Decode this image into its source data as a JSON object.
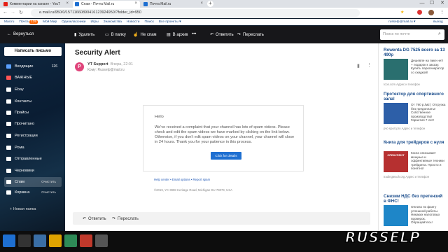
{
  "browser": {
    "tabs": [
      {
        "title": "Комментарии на канале - YouT",
        "fav": "#e62117"
      },
      {
        "title": "Спам - Почта Mail.ru",
        "fav": "#1e6fd1"
      },
      {
        "title": "Почта Mail.ru",
        "fav": "#1e6fd1"
      }
    ],
    "new_tab": "+",
    "url": "e.mail.ru/950/0/15711660890416123924950/?folder_id=950",
    "win_min": "—",
    "win_max": "☐",
    "win_close": "✕"
  },
  "mailnav": {
    "items": [
      "Mail.ru",
      "Почта",
      "Мой Мир",
      "Одноклассники",
      "Игры",
      "Знакомства",
      "Новости",
      "Поиск",
      "Все проекты ▾"
    ],
    "badge": "139",
    "user": "russelp@mail.ru ▾",
    "logout": "выход"
  },
  "toolbar": {
    "back": "Вернуться",
    "delete": "Удалить",
    "to_folder": "В папку",
    "not_spam": "Не спам",
    "archive": "В архив",
    "more": "•••",
    "reply": "Ответить",
    "forward": "Переслать"
  },
  "search": {
    "placeholder": "Поиск по почте"
  },
  "sidebar": {
    "compose": "Написать письмо",
    "folders": [
      {
        "label": "Входящие",
        "count": "126",
        "color": "#5aa0ff"
      },
      {
        "label": "ВАЖНЫЕ",
        "count": "",
        "color": "#ff5555"
      },
      {
        "label": "Ebay",
        "count": "",
        "color": "#ffffff"
      },
      {
        "label": "Контакты",
        "count": "",
        "color": "#ffffff"
      },
      {
        "label": "Прайсы",
        "count": "",
        "color": "#ffffff"
      },
      {
        "label": "Прочитано",
        "count": "",
        "color": "#ffffff"
      },
      {
        "label": "Регистрации",
        "count": "",
        "color": "#ffffff"
      },
      {
        "label": "Рома",
        "count": "",
        "color": "#ffffff"
      },
      {
        "label": "Отправленные",
        "count": "",
        "color": "#ffffff"
      },
      {
        "label": "Черновики",
        "count": "",
        "color": "#ffffff"
      },
      {
        "label": "Спам",
        "count": "",
        "color": "#ffffff"
      },
      {
        "label": "Корзина",
        "count": "",
        "color": "#ffffff"
      }
    ],
    "spam_clear": "Очистить",
    "trash_clear": "Очистить",
    "new_folder": "Новая папка"
  },
  "message": {
    "subject": "Security Alert",
    "avatar": "P",
    "from": "YT Support",
    "date": "Вчера, 22:01",
    "to": "Кому: Russelp@mail.ru",
    "body_hello": "Hello",
    "body_text": "We've received a complaint that your channel has lots of spam videos. Please check and edit the spam videos we have marked by clicking on the link below. Otherwise, if you don't edit spam videos on your channel, your channel will close in 24 hours. Thank you for your patience in this process.",
    "button": "Click for details",
    "footer_links": "Help center • Email options • Report spam",
    "footer_addr": "©2019, YC 3998 Heritage Road, Michigan DU 79079, USA",
    "reply": "Ответить",
    "forward": "Переслать"
  },
  "ads": [
    {
      "title": "Rowenta DG 7525 всего за 13 490р",
      "desc": "Дешевле на пике нет! + подарок к заказу. Купить парогенератор со скидкой!",
      "src": "Icon.com  Адрес и телефон"
    },
    {
      "title": "Протектор для спортивного зала!",
      "desc": "От 790 р./м2 | Отгрузка без предоплаты! Собственное производство! Гарантия 7 лет!",
      "src": "pvc-sport.pro  Адрес и телефон"
    },
    {
      "title": "Книга для трейдеров с нуля",
      "desc": "Книга описывает мощные и эффективные техники трейдинга. Просто и понятно!",
      "src": "tradingteach.org  Адрес и телефон"
    },
    {
      "title": "Снизим НДС без претензий в ФНС!",
      "desc": "Оплата по факту успешной работы. Никаких налоговых проверок. Обращайтесь!",
      "src": ""
    }
  ],
  "book_label": "СПЕКУЛЯНТ",
  "watermark": "RUSSELP"
}
